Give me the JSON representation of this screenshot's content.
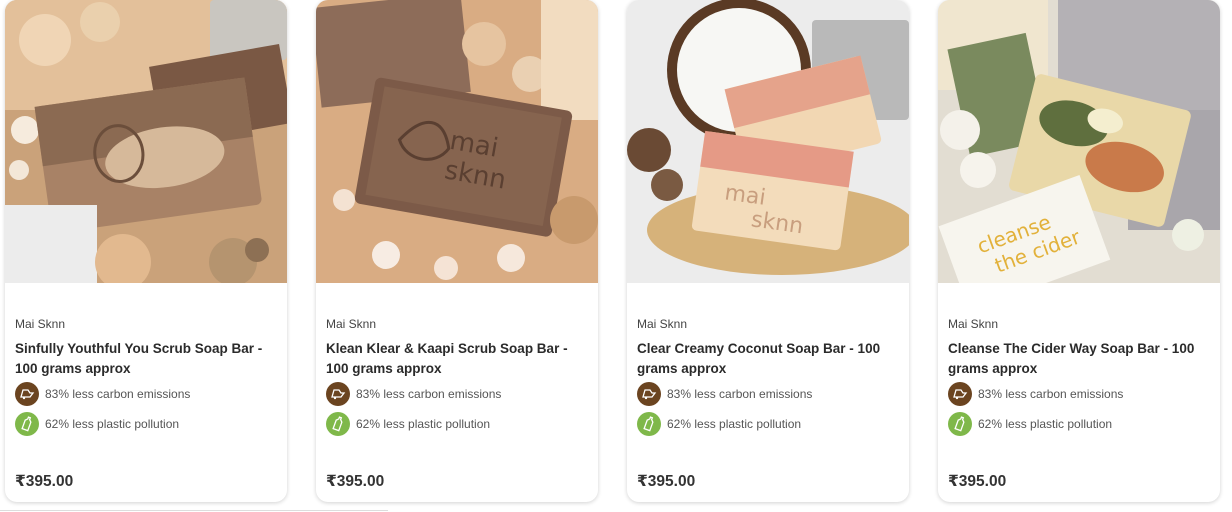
{
  "products": [
    {
      "brand": "Mai Sknn",
      "title": "Sinfully Youthful You Scrub Soap Bar - 100 grams approx",
      "carbon_text": "83% less carbon emissions",
      "plastic_text": "62% less plastic pollution",
      "price": "₹395.00"
    },
    {
      "brand": "Mai Sknn",
      "title": "Klean Klear & Kaapi Scrub Soap Bar - 100 grams approx",
      "carbon_text": "83% less carbon emissions",
      "plastic_text": "62% less plastic pollution",
      "price": "₹395.00"
    },
    {
      "brand": "Mai Sknn",
      "title": "Clear Creamy Coconut Soap Bar - 100 grams approx",
      "carbon_text": "83% less carbon emissions",
      "plastic_text": "62% less plastic pollution",
      "price": "₹395.00"
    },
    {
      "brand": "Mai Sknn",
      "title": "Cleanse The Cider Way Soap Bar - 100 grams approx",
      "carbon_text": "83% less carbon emissions",
      "plastic_text": "62% less plastic pollution",
      "price": "₹395.00"
    }
  ],
  "icons": {
    "carbon": "carbon-emission-icon",
    "plastic": "plastic-bottle-icon"
  },
  "colors": {
    "carbon_badge": "#6b4420",
    "plastic_badge": "#7fb84a",
    "price_text": "#333333",
    "title_text": "#2b2b2b"
  }
}
